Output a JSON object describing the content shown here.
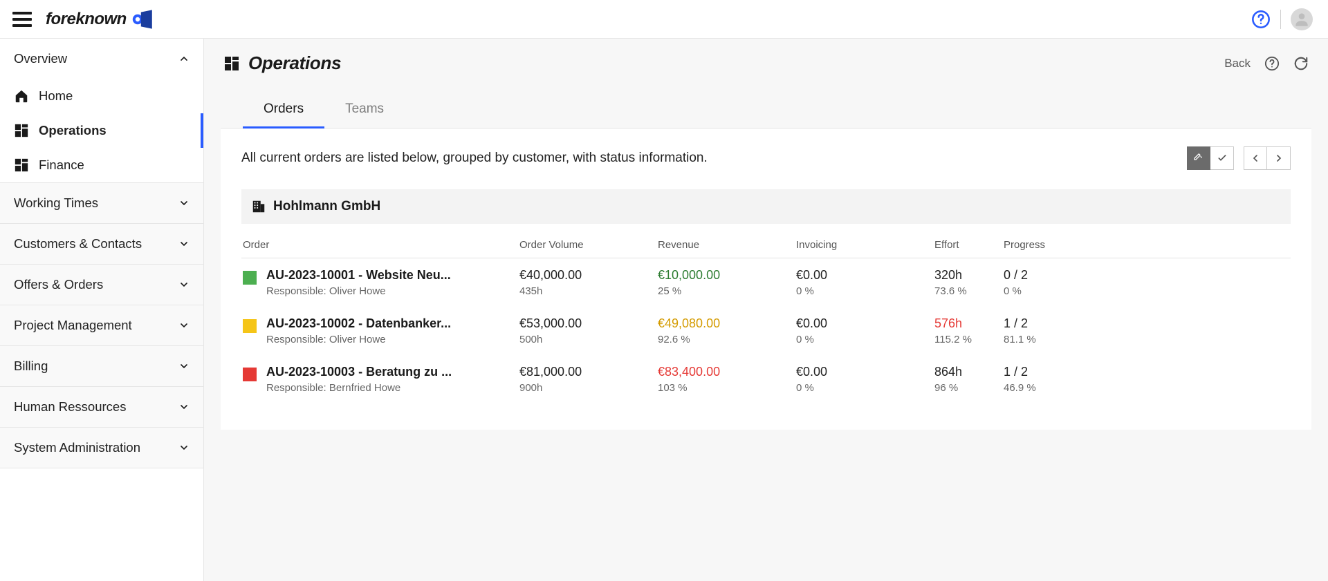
{
  "brand": "foreknown",
  "sidebar": {
    "groups": [
      {
        "label": "Overview",
        "expanded": true,
        "items": [
          {
            "id": "home",
            "label": "Home",
            "active": false
          },
          {
            "id": "operations",
            "label": "Operations",
            "active": true
          },
          {
            "id": "finance",
            "label": "Finance",
            "active": false
          }
        ]
      },
      {
        "label": "Working Times",
        "expanded": false
      },
      {
        "label": "Customers & Contacts",
        "expanded": false
      },
      {
        "label": "Offers & Orders",
        "expanded": false
      },
      {
        "label": "Project Management",
        "expanded": false
      },
      {
        "label": "Billing",
        "expanded": false
      },
      {
        "label": "Human Ressources",
        "expanded": false
      },
      {
        "label": "System Administration",
        "expanded": false
      }
    ]
  },
  "page": {
    "title": "Operations",
    "back": "Back"
  },
  "tabs": [
    {
      "label": "Orders",
      "active": true
    },
    {
      "label": "Teams",
      "active": false
    }
  ],
  "description": "All current orders are listed below, grouped by customer, with status information.",
  "company": "Hohlmann GmbH",
  "columns": {
    "order": "Order",
    "orderVolume": "Order Volume",
    "revenue": "Revenue",
    "invoicing": "Invoicing",
    "effort": "Effort",
    "progress": "Progress"
  },
  "rows": [
    {
      "status": "green",
      "name": "AU-2023-10001 - Website Neu...",
      "responsible": "Responsible: Oliver Howe",
      "volume": "€40,000.00",
      "volumeSub": "435h",
      "revenue": "€10,000.00",
      "revenueSub": "25 %",
      "revenueClass": "green",
      "invoicing": "€0.00",
      "invoicingSub": "0 %",
      "effort": "320h",
      "effortSub": "73.6 %",
      "effortClass": "",
      "progress": "0 / 2",
      "progressSub": "0 %"
    },
    {
      "status": "yellow",
      "name": "AU-2023-10002 - Datenbanker...",
      "responsible": "Responsible: Oliver Howe",
      "volume": "€53,000.00",
      "volumeSub": "500h",
      "revenue": "€49,080.00",
      "revenueSub": "92.6 %",
      "revenueClass": "yellow",
      "invoicing": "€0.00",
      "invoicingSub": "0 %",
      "effort": "576h",
      "effortSub": "115.2 %",
      "effortClass": "red",
      "progress": "1 / 2",
      "progressSub": "81.1 %"
    },
    {
      "status": "red",
      "name": "AU-2023-10003 - Beratung zu ...",
      "responsible": "Responsible: Bernfried Howe",
      "volume": "€81,000.00",
      "volumeSub": "900h",
      "revenue": "€83,400.00",
      "revenueSub": "103 %",
      "revenueClass": "red",
      "invoicing": "€0.00",
      "invoicingSub": "0 %",
      "effort": "864h",
      "effortSub": "96 %",
      "effortClass": "",
      "progress": "1 / 2",
      "progressSub": "46.9 %"
    }
  ]
}
